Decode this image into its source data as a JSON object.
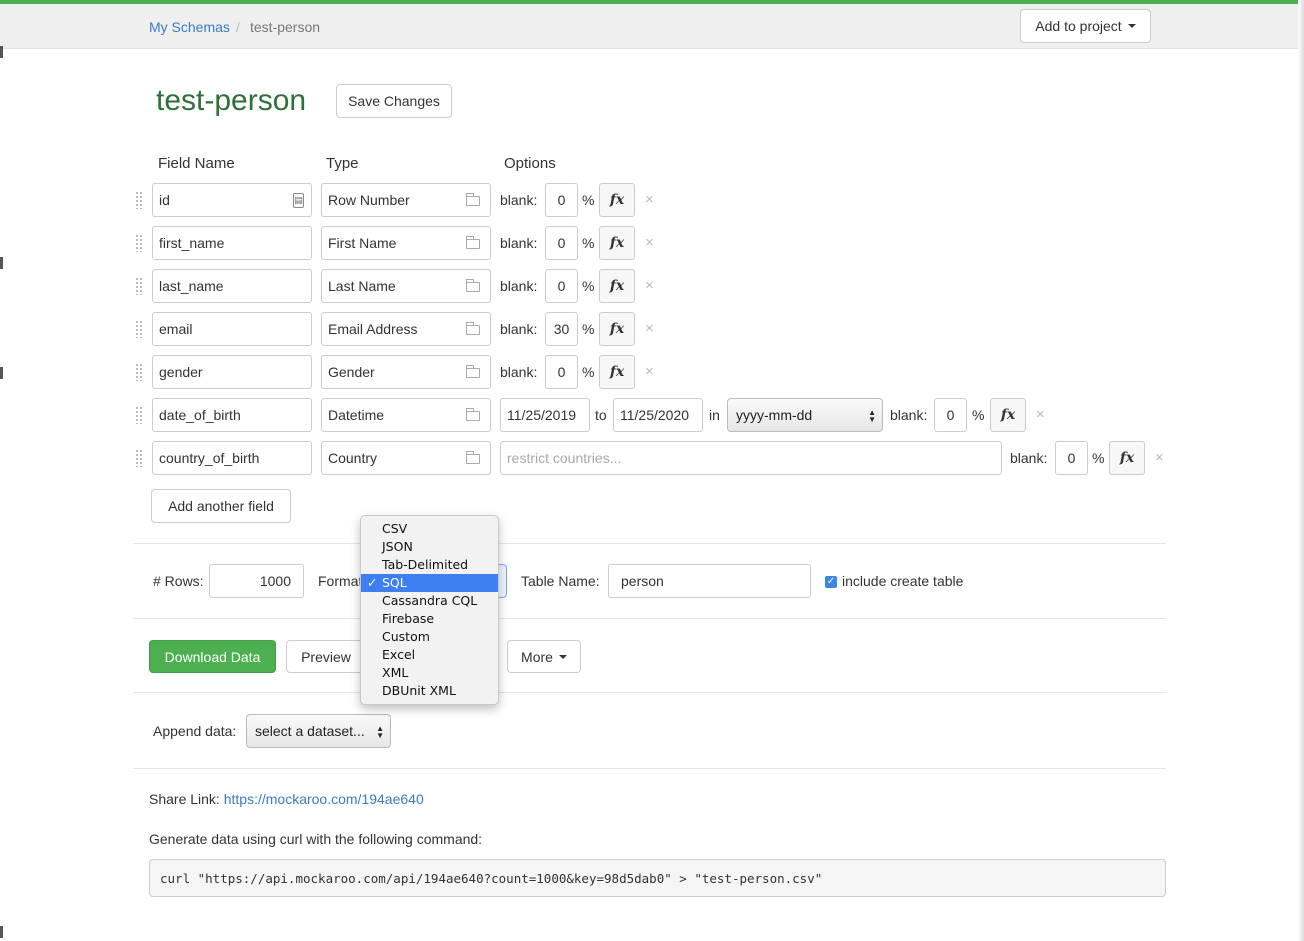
{
  "breadcrumb": {
    "root": "My Schemas",
    "separator": "/",
    "current": "test-person"
  },
  "header": {
    "add_to_project": "Add to project"
  },
  "schema": {
    "title": "test-person",
    "save_label": "Save Changes"
  },
  "columns": {
    "field_name": "Field Name",
    "type": "Type",
    "options": "Options"
  },
  "fields": [
    {
      "name": "id",
      "type": "Row Number",
      "blank": "0"
    },
    {
      "name": "first_name",
      "type": "First Name",
      "blank": "0"
    },
    {
      "name": "last_name",
      "type": "Last Name",
      "blank": "0"
    },
    {
      "name": "email",
      "type": "Email Address",
      "blank": "30"
    },
    {
      "name": "gender",
      "type": "Gender",
      "blank": "0"
    },
    {
      "name": "date_of_birth",
      "type": "Datetime",
      "blank": "0",
      "from": "11/25/2019",
      "to_word": "to",
      "to": "11/25/2020",
      "in_word": "in",
      "format": "yyyy-mm-dd"
    },
    {
      "name": "country_of_birth",
      "type": "Country",
      "blank": "0",
      "restrict_placeholder": "restrict countries..."
    }
  ],
  "labels": {
    "blank": "blank:",
    "percent": "%",
    "fx": "fx",
    "remove": "×"
  },
  "add_field_label": "Add another field",
  "generation": {
    "rows_label": "# Rows:",
    "rows_value": "1000",
    "format_label": "Format:",
    "format_options": [
      "CSV",
      "JSON",
      "Tab-Delimited",
      "SQL",
      "Cassandra CQL",
      "Firebase",
      "Custom",
      "Excel",
      "XML",
      "DBUnit XML"
    ],
    "format_selected": "SQL",
    "table_name_label": "Table Name:",
    "table_name_value": "person",
    "include_create_table": "include create table"
  },
  "actions": {
    "download": "Download Data",
    "preview": "Preview",
    "more": "More"
  },
  "append": {
    "label": "Append data:",
    "select_value": "select a dataset..."
  },
  "share": {
    "label": "Share Link:",
    "url": "https://mockaroo.com/194ae640"
  },
  "curl": {
    "intro": "Generate data using curl with the following command:",
    "command": "curl \"https://api.mockaroo.com/api/194ae640?count=1000&key=98d5dab0\" > \"test-person.csv\""
  },
  "colors": {
    "accent_green": "#4caf50",
    "title_green": "#2e6f3a",
    "link_blue": "#3a7bc8",
    "select_blue": "#3d7ff0"
  }
}
